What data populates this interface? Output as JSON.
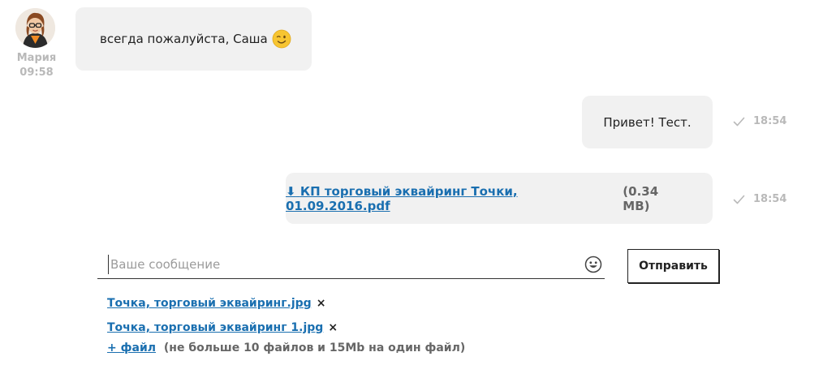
{
  "incoming": {
    "sender_name": "Мария",
    "time": "09:58",
    "text": "всегда пожалуйста, Саша",
    "emoji": "wink-emoji"
  },
  "outgoing": [
    {
      "text": "Привет! Тест.",
      "time": "18:54",
      "status_icon": "check-icon"
    },
    {
      "arrow": "⬇",
      "file_name": "КП торговый эквайринг Точки, 01.09.2016.pdf",
      "file_size": "(0.34 MB)",
      "time": "18:54",
      "status_icon": "check-icon"
    }
  ],
  "composer": {
    "placeholder": "Ваше сообщение",
    "emoji_button_icon": "smiley-icon",
    "send_label": "Отправить"
  },
  "attachments": [
    {
      "name": "Точка, торговый эквайринг.jpg",
      "remove": "×"
    },
    {
      "name": "Точка, торговый эквайринг 1.jpg",
      "remove": "×"
    }
  ],
  "add_file": {
    "link": "+ файл",
    "hint": "(не больше 10 файлов и 15Mb на один файл)"
  },
  "colors": {
    "bubble": "#f1f1f1",
    "link": "#1a6fb0",
    "muted": "#b9b9b9"
  }
}
